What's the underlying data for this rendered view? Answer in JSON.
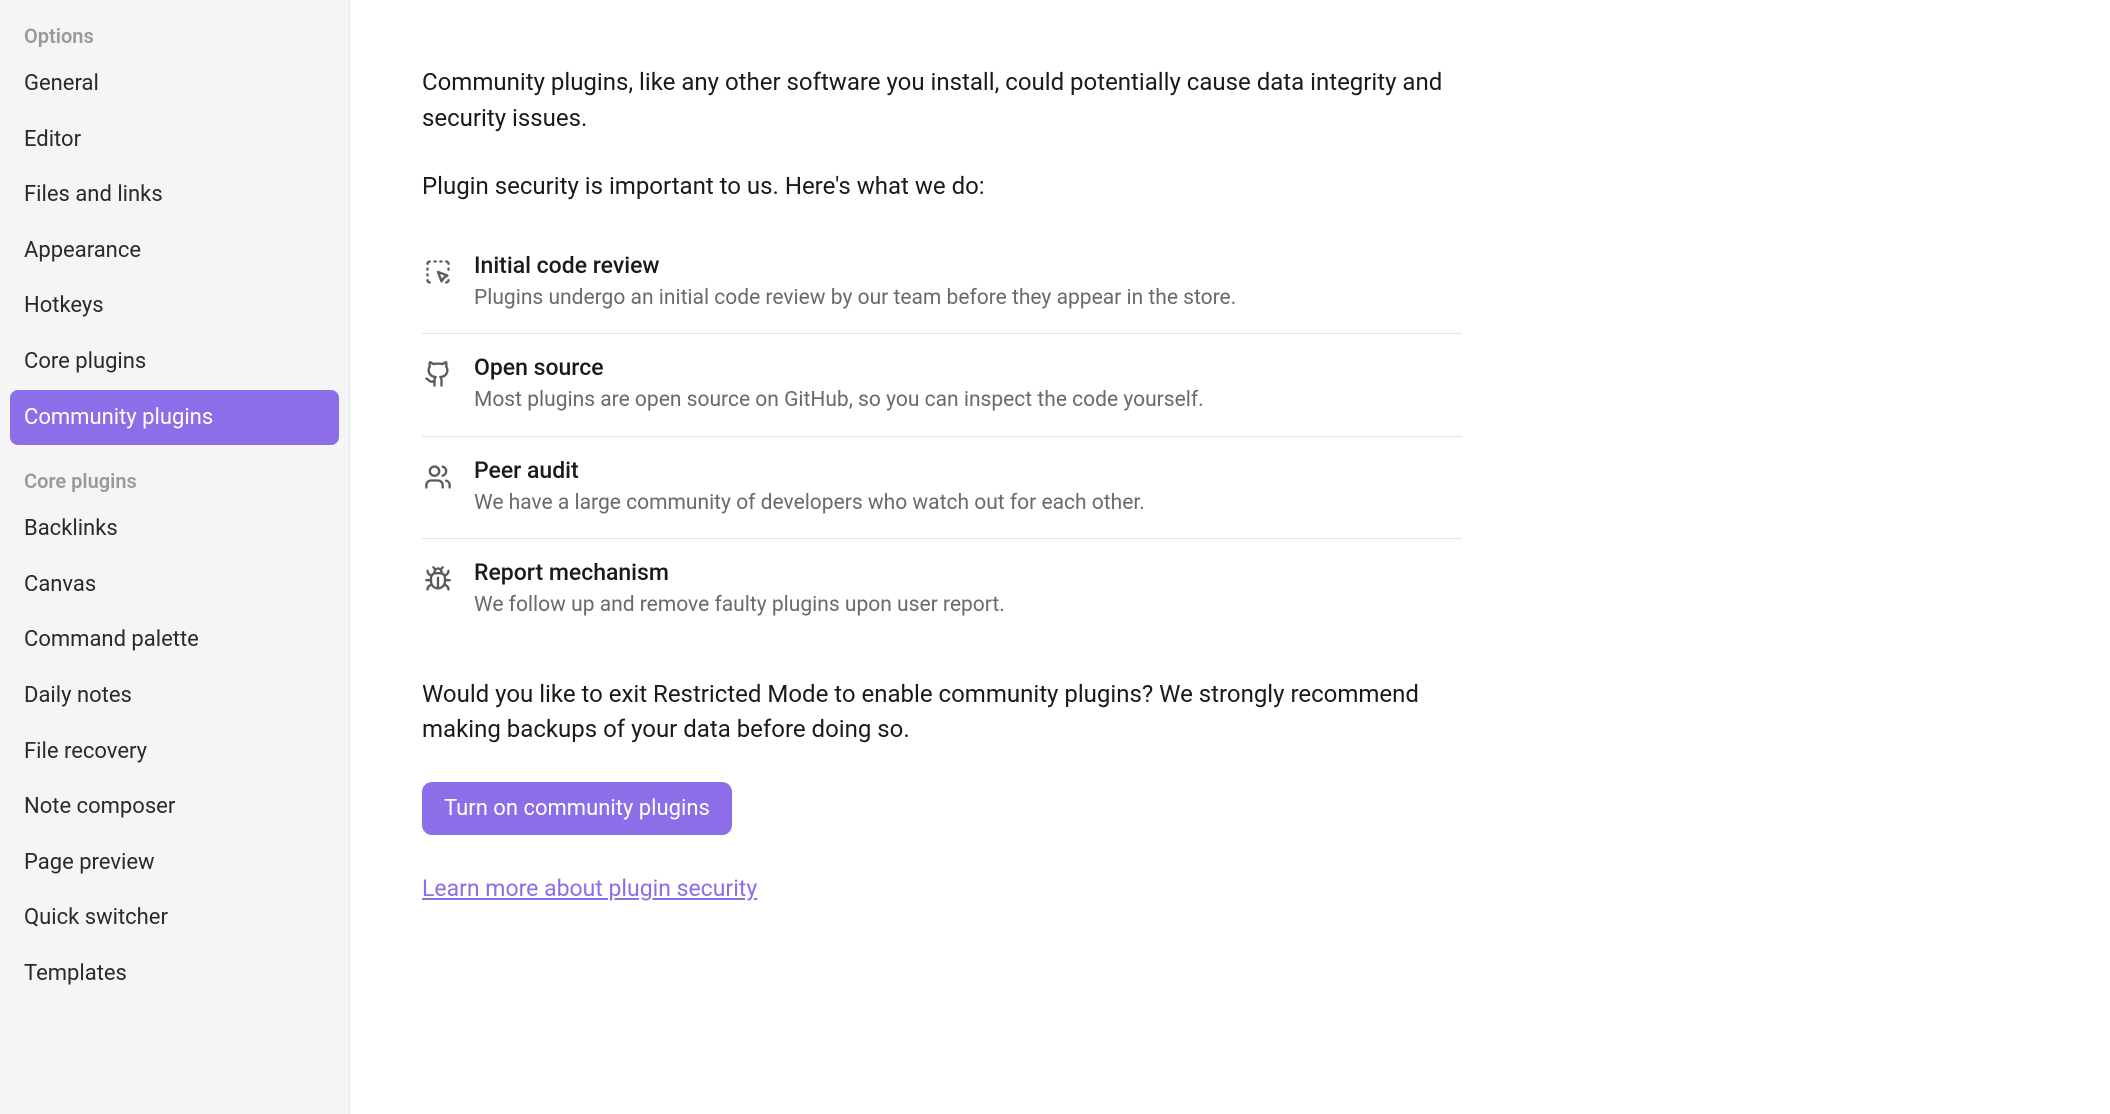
{
  "sidebar": {
    "sections": [
      {
        "header": "Options",
        "items": [
          {
            "label": "General",
            "active": false
          },
          {
            "label": "Editor",
            "active": false
          },
          {
            "label": "Files and links",
            "active": false
          },
          {
            "label": "Appearance",
            "active": false
          },
          {
            "label": "Hotkeys",
            "active": false
          },
          {
            "label": "Core plugins",
            "active": false
          },
          {
            "label": "Community plugins",
            "active": true
          }
        ]
      },
      {
        "header": "Core plugins",
        "items": [
          {
            "label": "Backlinks",
            "active": false
          },
          {
            "label": "Canvas",
            "active": false
          },
          {
            "label": "Command palette",
            "active": false
          },
          {
            "label": "Daily notes",
            "active": false
          },
          {
            "label": "File recovery",
            "active": false
          },
          {
            "label": "Note composer",
            "active": false
          },
          {
            "label": "Page preview",
            "active": false
          },
          {
            "label": "Quick switcher",
            "active": false
          },
          {
            "label": "Templates",
            "active": false
          }
        ]
      }
    ]
  },
  "main": {
    "intro": "Community plugins, like any other software you install, could potentially cause data integrity and security issues.",
    "security_intro": "Plugin security is important to us. Here's what we do:",
    "security_items": [
      {
        "icon": "cursor-review-icon",
        "title": "Initial code review",
        "desc": "Plugins undergo an initial code review by our team before they appear in the store."
      },
      {
        "icon": "github-icon",
        "title": "Open source",
        "desc": "Most plugins are open source on GitHub, so you can inspect the code yourself."
      },
      {
        "icon": "users-icon",
        "title": "Peer audit",
        "desc": "We have a large community of developers who watch out for each other."
      },
      {
        "icon": "bug-icon",
        "title": "Report mechanism",
        "desc": "We follow up and remove faulty plugins upon user report."
      }
    ],
    "exit_text": "Would you like to exit Restricted Mode to enable community plugins? We strongly recommend making backups of your data before doing so.",
    "button_label": "Turn on community plugins",
    "learn_link": "Learn more about plugin security"
  }
}
